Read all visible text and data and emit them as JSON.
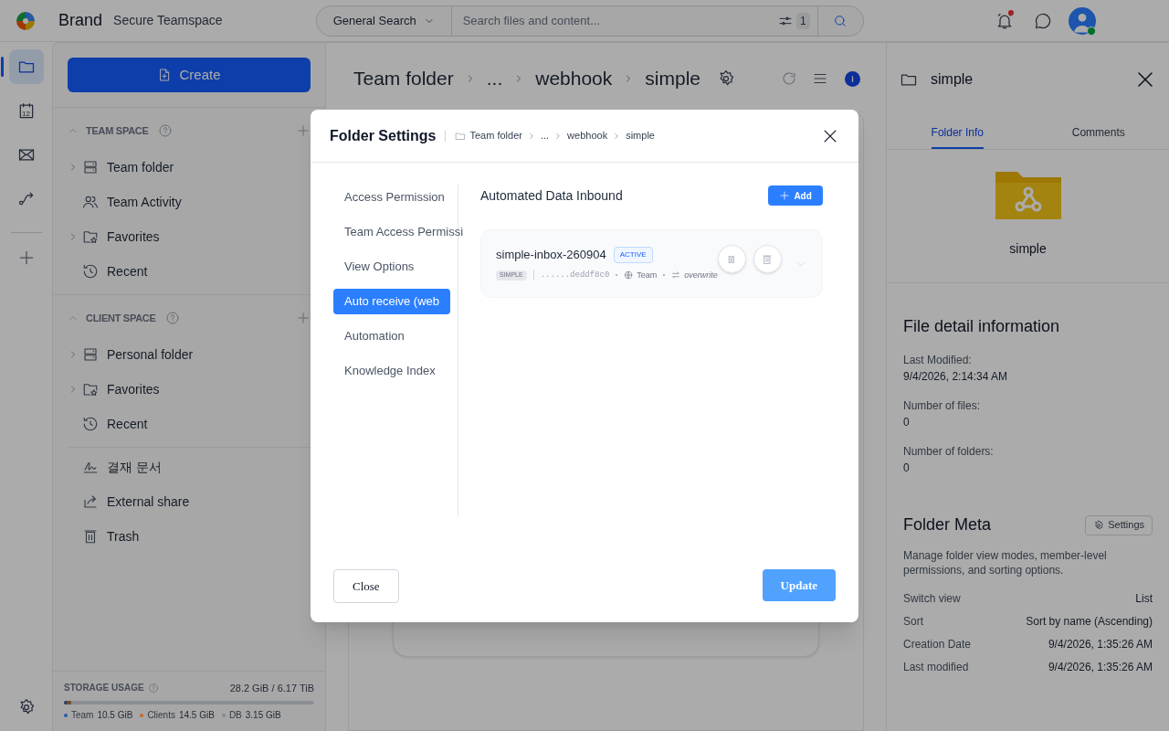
{
  "header": {
    "brand": "Brand",
    "subtitle": "Secure Teamspace",
    "search": {
      "scope": "General Search",
      "placeholder": "Search files and content...",
      "filter_count": "1"
    },
    "notifications": {
      "unread": true
    },
    "avatar": {
      "online": true
    }
  },
  "rail": {
    "items": [
      {
        "kind": "folder",
        "selected": true
      },
      {
        "kind": "calendar",
        "selected": false,
        "text": "12"
      },
      {
        "kind": "mail",
        "selected": false
      },
      {
        "kind": "flow",
        "selected": false
      }
    ]
  },
  "sidebar": {
    "create_label": "Create",
    "sections": [
      {
        "title": "TEAM SPACE",
        "items": [
          {
            "label": "Team folder",
            "kind": "drive",
            "expandable": true
          },
          {
            "label": "Team Activity",
            "kind": "people",
            "expandable": false
          },
          {
            "label": "Favorites",
            "kind": "star-folder",
            "expandable": true
          },
          {
            "label": "Recent",
            "kind": "history",
            "expandable": false
          }
        ]
      },
      {
        "title": "CLIENT SPACE",
        "items": [
          {
            "label": "Personal folder",
            "kind": "drive",
            "expandable": true
          },
          {
            "label": "Favorites",
            "kind": "star-folder",
            "expandable": true
          },
          {
            "label": "Recent",
            "kind": "history",
            "expandable": false
          }
        ]
      }
    ],
    "extra_items": [
      {
        "label": "결재 문서",
        "kind": "signature"
      },
      {
        "label": "External share",
        "kind": "share"
      },
      {
        "label": "Trash",
        "kind": "trash"
      }
    ],
    "storage": {
      "title": "STORAGE USAGE",
      "total": "28.2 GiB / 6.17 TiB",
      "legend": [
        {
          "label": "Team",
          "value": "10.5 GiB",
          "color": "#2a5db5",
          "level": 0.012
        },
        {
          "label": "Clients",
          "value": "14.5 GiB",
          "color": "#c86a28",
          "level": 0.012
        },
        {
          "label": "DB",
          "value": "3.15 GiB",
          "color": "#8a8a8a",
          "level": 0.006
        }
      ]
    }
  },
  "main": {
    "breadcrumb": [
      "Team folder",
      "...",
      "webhook",
      "simple"
    ]
  },
  "right_panel": {
    "title": "simple",
    "tabs": [
      {
        "label": "Folder Info",
        "selected": true
      },
      {
        "label": "Comments",
        "selected": false
      }
    ],
    "folder_name": "simple",
    "details_title": "File detail information",
    "fields": [
      {
        "label": "Last Modified:",
        "value": "9/4/2026, 2:14:34 AM"
      },
      {
        "label": "Number of files:",
        "value": "0"
      },
      {
        "label": "Number of folders:",
        "value": "0"
      }
    ],
    "meta": {
      "title": "Folder Meta",
      "settings_label": "Settings",
      "description": "Manage folder view modes, member-level permissions, and sorting options.",
      "rows": [
        {
          "label": "Switch view",
          "value": "List"
        },
        {
          "label": "Sort",
          "value": "Sort by name (Ascending)"
        },
        {
          "label": "Creation Date",
          "value": "9/4/2026, 1:35:26 AM"
        },
        {
          "label": "Last modified",
          "value": "9/4/2026, 1:35:26 AM"
        }
      ]
    }
  },
  "modal": {
    "title": "Folder Settings",
    "breadcrumb": [
      "Team folder",
      "...",
      "webhook",
      "simple"
    ],
    "menu": [
      {
        "label": "Access Permission",
        "selected": false
      },
      {
        "label": "Team Access Permissi",
        "selected": false
      },
      {
        "label": "View Options",
        "selected": false
      },
      {
        "label": "Auto receive (web",
        "selected": true
      },
      {
        "label": "Automation",
        "selected": false
      },
      {
        "label": "Knowledge Index",
        "selected": false
      }
    ],
    "section_title": "Automated Data Inbound",
    "add_label": "Add",
    "inbounds": [
      {
        "name": "simple-inbox-260904",
        "status": "ACTIVE",
        "type": "SIMPLE",
        "token": "......deddf8c0",
        "scope": "Team",
        "mode": "overwrite"
      }
    ],
    "close_label": "Close",
    "update_label": "Update"
  }
}
